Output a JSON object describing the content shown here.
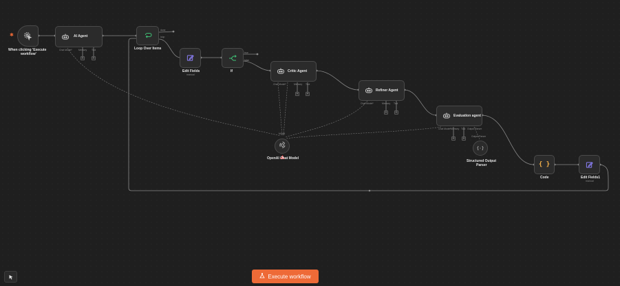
{
  "nodes": {
    "trigger": {
      "title_line1": "When clicking 'Execute",
      "title_line2": "workflow'"
    },
    "ai_agent": {
      "title": "AI Agent",
      "ports": [
        "Chat Model*",
        "Memory",
        "Tool"
      ]
    },
    "loop": {
      "title": "Loop Over Items",
      "outputs": [
        "done",
        "loop"
      ]
    },
    "edit_fields": {
      "title": "Edit Fields",
      "subtitle": "manual"
    },
    "if": {
      "title": "If",
      "outputs": [
        "true",
        "false"
      ]
    },
    "critic": {
      "title": "Critic Agent",
      "ports": [
        "Chat Model*",
        "Memory",
        "Tool"
      ]
    },
    "refiner": {
      "title": "Refiner Agent",
      "ports": [
        "Chat Model*",
        "Memory",
        "Tool"
      ]
    },
    "evaluation": {
      "title": "Evaluation agent",
      "ports": [
        "Chat Model*",
        "Memory",
        "Tool",
        "Output Parser"
      ]
    },
    "openai": {
      "title": "OpenAI Chat Model",
      "port_label": "Model"
    },
    "parser": {
      "title_line1": "Structured Output",
      "title_line2": "Parser",
      "port_label": "Output Parser"
    },
    "code": {
      "title": "Code"
    },
    "edit_fields1": {
      "title": "Edit Fields1",
      "subtitle": "manual"
    }
  },
  "toolbar": {
    "execute_label": "Execute workflow"
  },
  "colors": {
    "accent": "#ee6a37",
    "edit_icon": "#8b7ff5",
    "if_icon": "#3fbf75",
    "code_icon": "#f5b14a",
    "warning": "#e04848"
  }
}
